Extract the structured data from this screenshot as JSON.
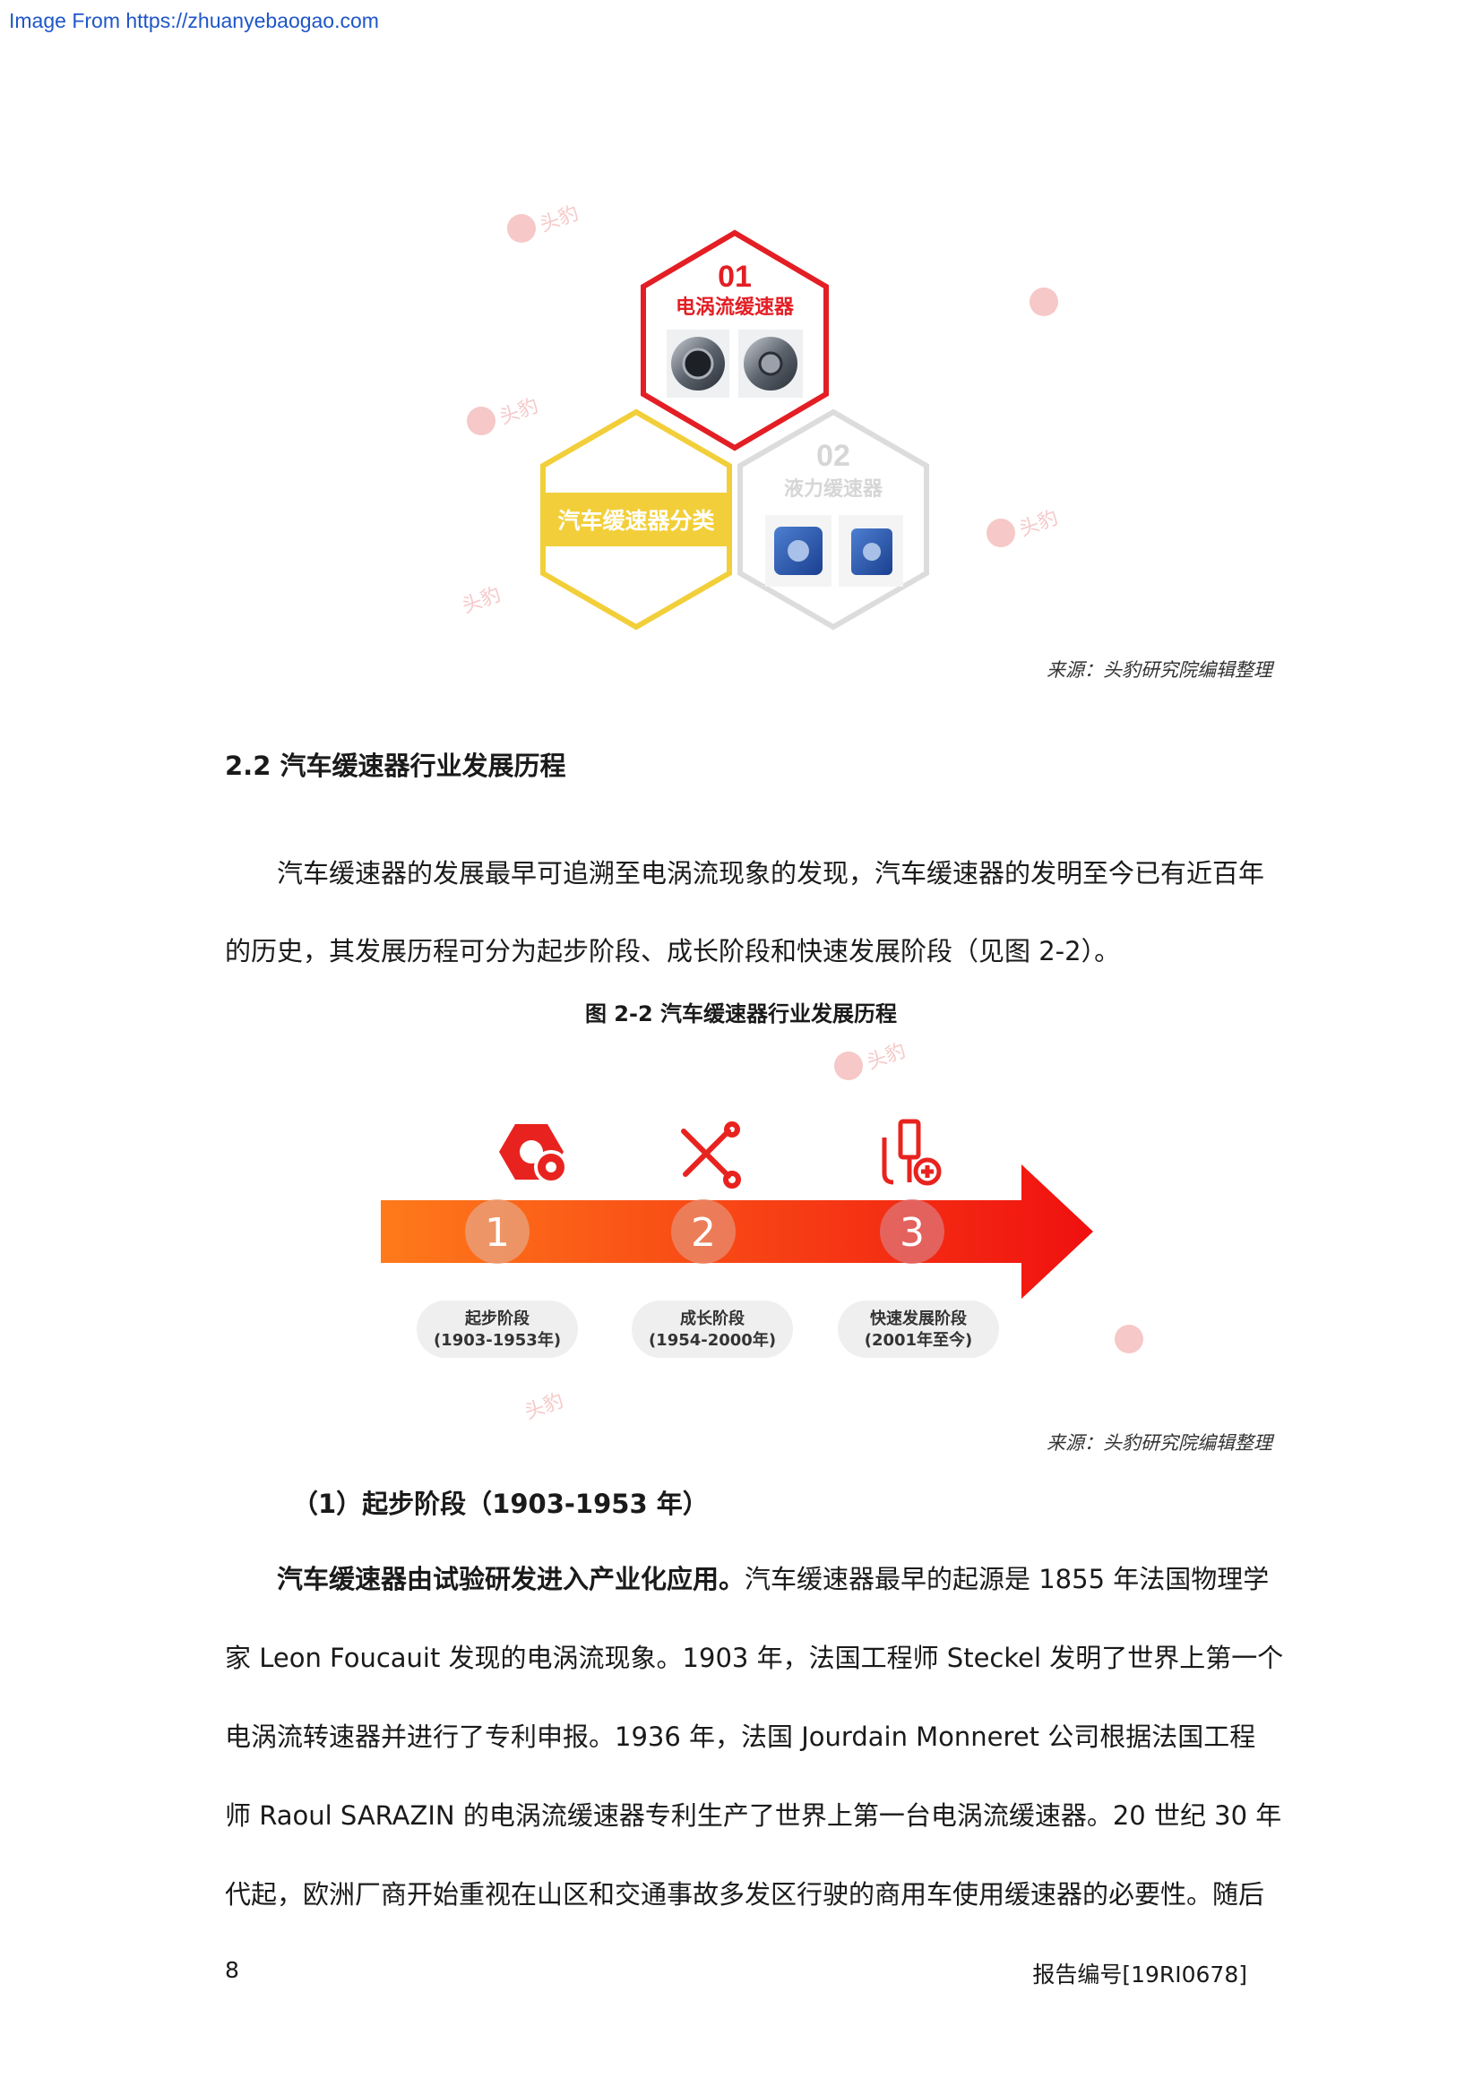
{
  "source_link": "Image From https://zhuanyebaogao.com",
  "figure1": {
    "hex1": {
      "number": "01",
      "label": "电涡流缓速器"
    },
    "hex2": {
      "label": "汽车缓速器分类"
    },
    "hex3": {
      "number": "02",
      "label": "液力缓速器"
    },
    "source": "来源：头豹研究院编辑整理"
  },
  "section": {
    "heading": "2.2 汽车缓速器行业发展历程",
    "paragraph_lines": [
      "汽车缓速器的发展最早可追溯至电涡流现象的发现，汽车缓速器的发明至今已有近百年",
      "的历史，其发展历程可分为起步阶段、成长阶段和快速发展阶段（见图 2-2）。"
    ]
  },
  "figure2": {
    "caption": "图 2-2 汽车缓速器行业发展历程",
    "stages": [
      {
        "number": "1",
        "name": "起步阶段",
        "period": "(1903-1953年)",
        "icon": "gear-icon"
      },
      {
        "number": "2",
        "name": "成长阶段",
        "period": "(1954-2000年)",
        "icon": "wrench-screwdriver-icon"
      },
      {
        "number": "3",
        "name": "快速发展阶段",
        "period": "(2001年至今)",
        "icon": "tools-plus-icon"
      }
    ],
    "source": "来源：头豹研究院编辑整理",
    "colors": {
      "arrow_start": "#ff7a1a",
      "arrow_end": "#f01010",
      "icon": "#e8231f"
    }
  },
  "subsection": {
    "heading": "（1）起步阶段（1903-1953 年）",
    "bold_lead": "汽车缓速器由试验研发进入产业化应用。",
    "first_line_rest": "汽车缓速器最早的起源是 1855 年法国物理学",
    "lines": [
      "家 Leon Foucauit 发现的电涡流现象。1903 年，法国工程师 Steckel 发明了世界上第一个",
      "电涡流转速器并进行了专利申报。1936 年，法国 Jourdain Monneret 公司根据法国工程",
      "师 Raoul SARAZIN 的电涡流缓速器专利生产了世界上第一台电涡流缓速器。20 世纪 30 年",
      "代起，欧洲厂商开始重视在山区和交通事故多发区行驶的商用车使用缓速器的必要性。随后"
    ]
  },
  "footer": {
    "page_number": "8",
    "report_no": "报告编号[19RI0678]"
  },
  "watermark_text": "头豹"
}
